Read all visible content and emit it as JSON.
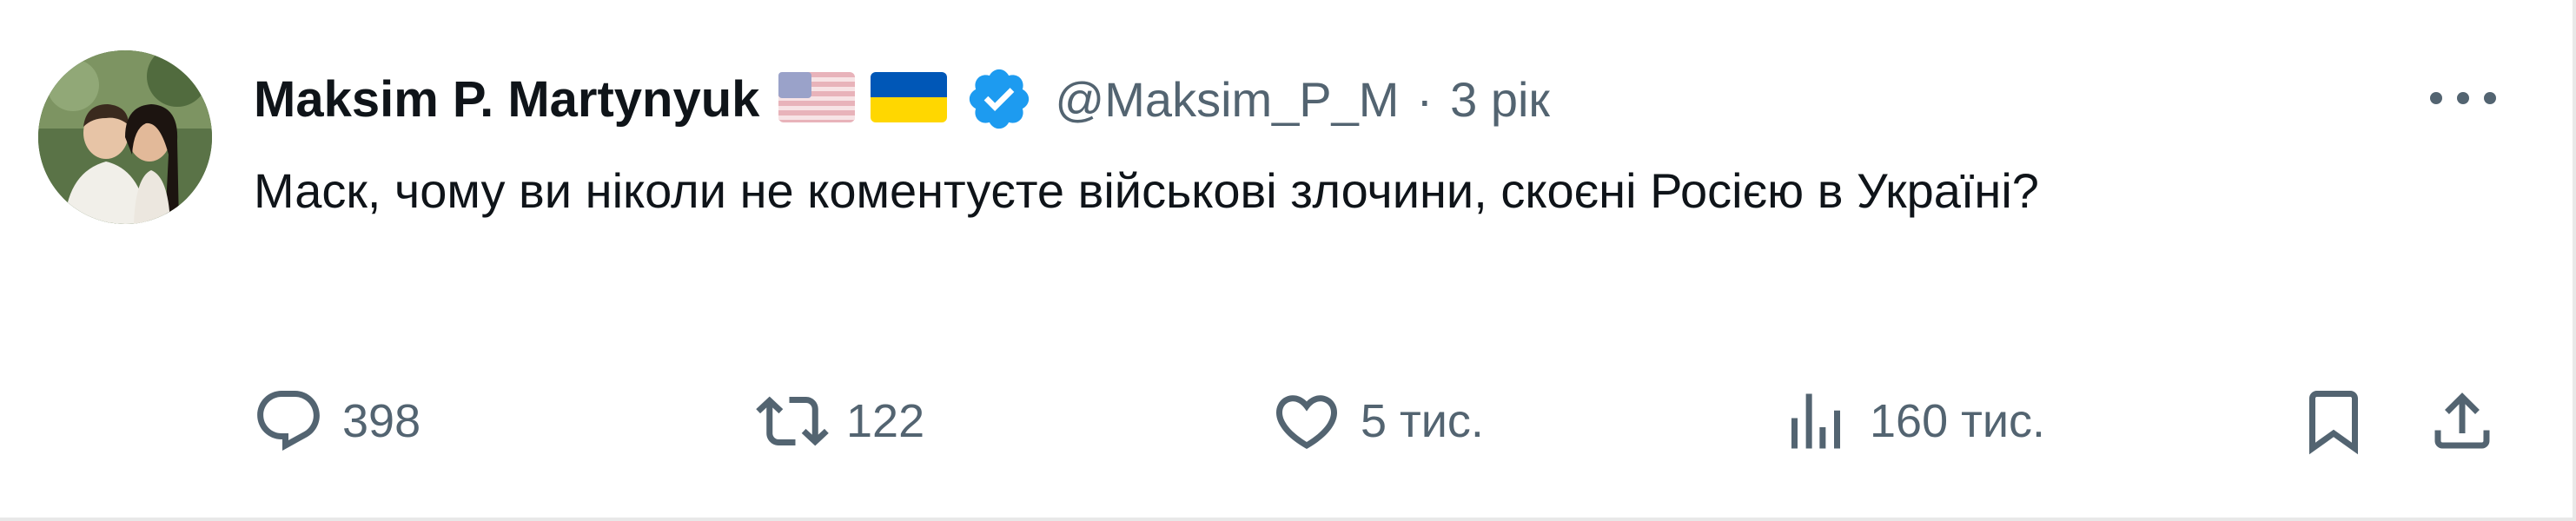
{
  "tweet": {
    "author_name": "Maksim P. Martynyuk",
    "flags": [
      "us-flag-icon",
      "ukraine-flag-icon"
    ],
    "verified_icon": "verified-badge-icon",
    "handle": "@Maksim_P_M",
    "separator": "·",
    "time": "3 рік",
    "text": "Маск, чому ви ніколи не коментуєте військові злочини, скоєні Росією в Україні?",
    "more_icon": "more-icon"
  },
  "actions": {
    "replies": {
      "icon": "reply-icon",
      "count": "398"
    },
    "retweets": {
      "icon": "retweet-icon",
      "count": "122"
    },
    "likes": {
      "icon": "heart-icon",
      "count": "5 тис."
    },
    "views": {
      "icon": "views-icon",
      "count": "160 тис."
    },
    "bookmark": {
      "icon": "bookmark-icon"
    },
    "share": {
      "icon": "share-icon"
    }
  },
  "colors": {
    "text": "#0f1419",
    "secondary": "#536471",
    "verified": "#1d9bf0",
    "flag_blue": "#0057b7",
    "flag_yellow": "#ffd700"
  }
}
